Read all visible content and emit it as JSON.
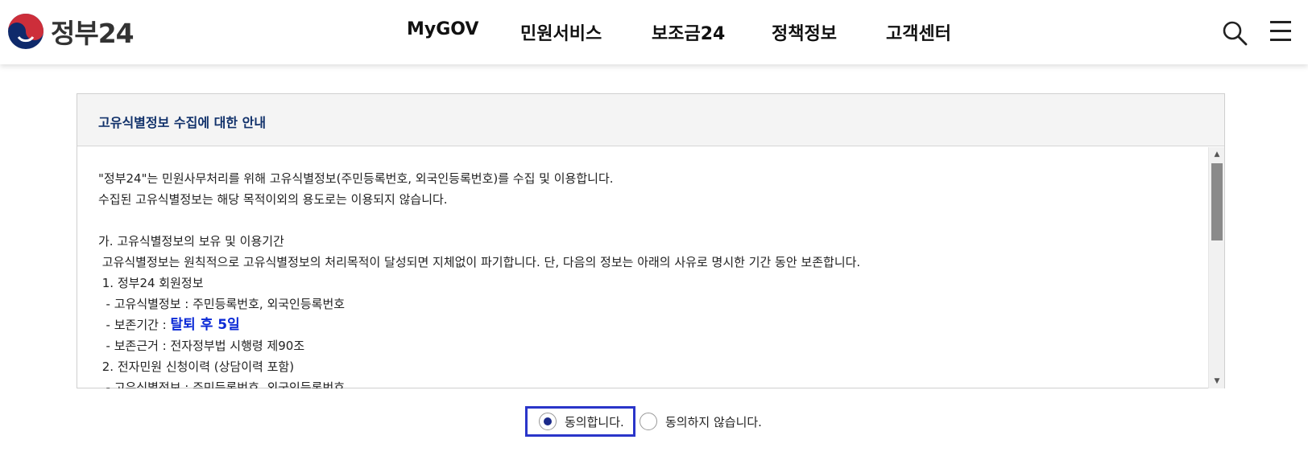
{
  "header": {
    "logo_text": "정부24",
    "nav": [
      "MyGOV",
      "민원서비스",
      "보조금24",
      "정책정보",
      "고객센터"
    ]
  },
  "panel": {
    "title": "고유식별정보 수집에 대한 안내",
    "lines": [
      "\"정부24\"는 민원사무처리를 위해 고유식별정보(주민등록번호, 외국인등록번호)를 수집 및 이용합니다.",
      "수집된 고유식별정보는 해당 목적이외의 용도로는 이용되지 않습니다.",
      "",
      "가. 고유식별정보의 보유 및 이용기간",
      " 고유식별정보는 원칙적으로 고유식별정보의 처리목적이 달성되면 지체없이 파기합니다. 단, 다음의 정보는 아래의 사유로 명시한 기간 동안 보존합니다.",
      " 1. 정부24 회원정보",
      "  - 고유식별정보 : 주민등록번호, 외국인등록번호",
      "  - 보존기간 : ",
      "  - 보존근거 : 전자정부법 시행령 제90조",
      " 2. 전자민원 신청이력 (상담이력 포함)",
      "  - 고유식별정보 : 주민등록번호, 외국인등록번호"
    ],
    "retention_highlight": "탈퇴 후 5일"
  },
  "consent": {
    "agree_label": "동의합니다.",
    "disagree_label": "동의하지 않습니다.",
    "selected": "agree"
  },
  "colors": {
    "title": "#12326b",
    "highlight": "#0b2ad6",
    "focus_border": "#2a35c9",
    "logo_red": "#cd2e3a",
    "logo_blue": "#0f2a6b"
  }
}
